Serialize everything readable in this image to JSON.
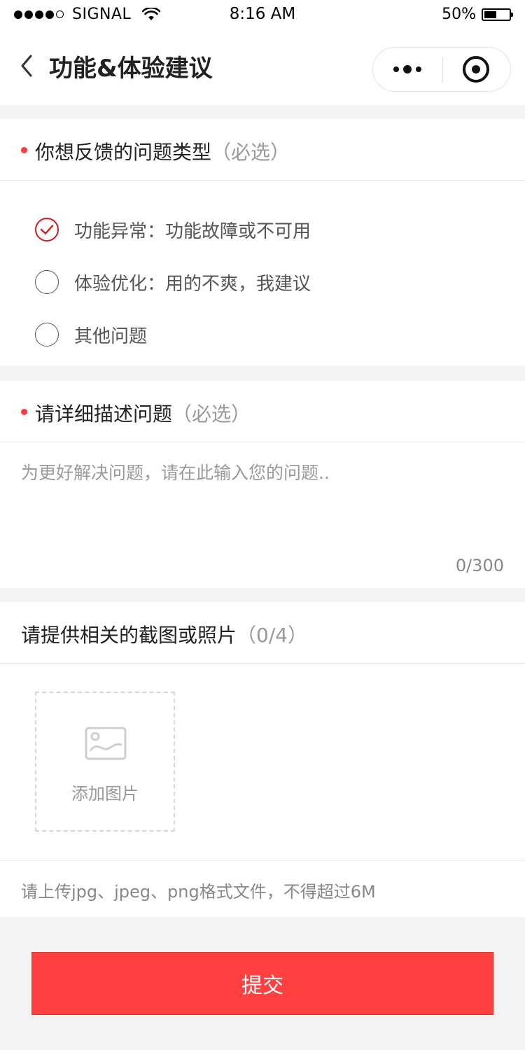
{
  "status_bar": {
    "carrier": "SIGNAL",
    "time": "8:16 AM",
    "battery_percent_text": "50%",
    "battery_level": 0.5
  },
  "nav": {
    "title": "功能&体验建议"
  },
  "feedback_type": {
    "label": "你想反馈的问题类型",
    "hint": "（必选）",
    "options": [
      {
        "label": "功能异常：功能故障或不可用",
        "checked": true
      },
      {
        "label": "体验优化：用的不爽，我建议",
        "checked": false
      },
      {
        "label": "其他问题",
        "checked": false
      }
    ]
  },
  "description": {
    "label": "请详细描述问题",
    "hint": "（必选）",
    "placeholder": "为更好解决问题，请在此输入您的问题..",
    "value": "",
    "counter": "0/300"
  },
  "screenshots": {
    "label": "请提供相关的截图或照片",
    "count_text": "（0/4）",
    "add_label": "添加图片",
    "note": "请上传jpg、jpeg、png格式文件，不得超过6M"
  },
  "submit_label": "提交",
  "colors": {
    "accent": "#ff4040",
    "required_dot": "#ff3b3b",
    "checked_radio": "#d0191f",
    "page_bg": "#f3f3f3"
  }
}
